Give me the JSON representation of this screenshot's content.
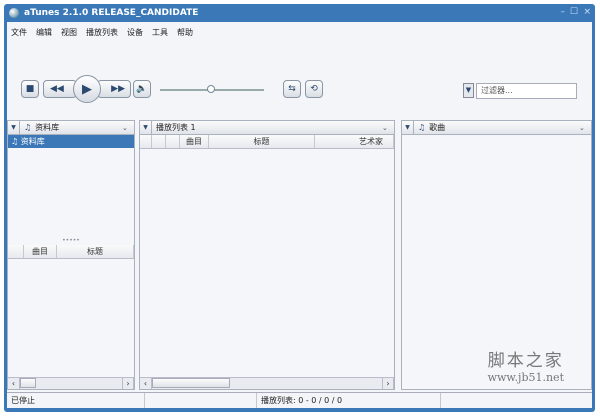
{
  "window": {
    "title": "aTunes 2.1.0 RELEASE_CANDIDATE"
  },
  "menu": [
    "文件",
    "编辑",
    "视图",
    "播放列表",
    "设备",
    "工具",
    "帮助"
  ],
  "filter": {
    "placeholder": "过滤器..."
  },
  "player": {
    "volume_percent": 50
  },
  "left_panel": {
    "header": "资料库",
    "items": [
      "资料库"
    ],
    "columns": [
      "曲目",
      "标题"
    ]
  },
  "middle_panel": {
    "header": "播放列表 1",
    "columns": [
      "曲目",
      "标题",
      "艺术家"
    ]
  },
  "right_panel": {
    "header": "歌曲"
  },
  "status": {
    "state": "已停止",
    "playlist": "播放列表: 0 - 0 / 0 / 0"
  },
  "watermark": {
    "line1": "脚本之家",
    "line2": "www.jb51.net"
  }
}
